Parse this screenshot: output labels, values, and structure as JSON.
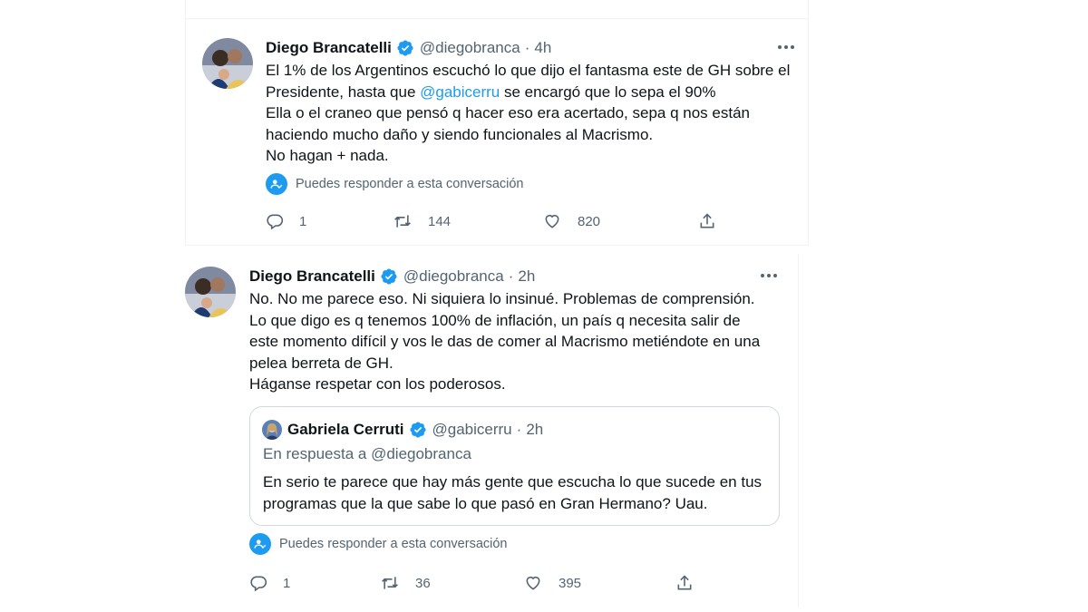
{
  "tweet1": {
    "name": "Diego Brancatelli",
    "handle": "@diegobranca",
    "separator": "·",
    "time": "4h",
    "lines": {
      "l1": "El 1% de los Argentinos escuchó lo que dijo el fantasma este de GH sobre el",
      "l2_pre": "Presidente, hasta que ",
      "l2_mention": "@gabicerru",
      "l2_post": " se encargó que lo sepa el 90%",
      "l3": "Ella o el craneo que pensó q hacer eso era acertado, sepa q nos están",
      "l4": "haciendo mucho daño y siendo funcionales al Macrismo.",
      "l5": "No hagan + nada."
    },
    "reply_note": "Puedes responder a esta conversación",
    "replies": "1",
    "retweets": "144",
    "likes": "820"
  },
  "tweet2": {
    "name": "Diego Brancatelli",
    "handle": "@diegobranca",
    "separator": "·",
    "time": "2h",
    "lines": [
      "No. No me parece eso. Ni siquiera lo insinué. Problemas de comprensión.",
      "Lo que digo es q tenemos 100% de inflación, un país q necesita salir de",
      "este momento difícil y vos le das de comer al Macrismo metiéndote en una",
      "pelea berreta de GH.",
      "Háganse respetar con los poderosos."
    ],
    "quote": {
      "name": "Gabriela Cerruti",
      "handle": "@gabicerru",
      "separator": "·",
      "time": "2h",
      "in_reply_to": "En respuesta a @diegobranca",
      "lines": [
        "En serio te parece que hay más gente que escucha lo que sucede en tus",
        "programas que la que sabe lo que pasó en Gran Hermano? Uau."
      ]
    },
    "reply_note": "Puedes responder a esta conversación",
    "replies": "1",
    "retweets": "36",
    "likes": "395"
  },
  "icons": {
    "verified": "verified-badge-icon",
    "more": "more-options-icon",
    "reply": "reply-icon",
    "retweet": "retweet-icon",
    "like": "like-icon",
    "share": "share-icon",
    "reply_restriction": "mention-person-icon"
  },
  "colors": {
    "accent": "#1d9bf0",
    "secondary_text": "#536471",
    "text": "#0f1419",
    "border": "#cfd9de"
  }
}
